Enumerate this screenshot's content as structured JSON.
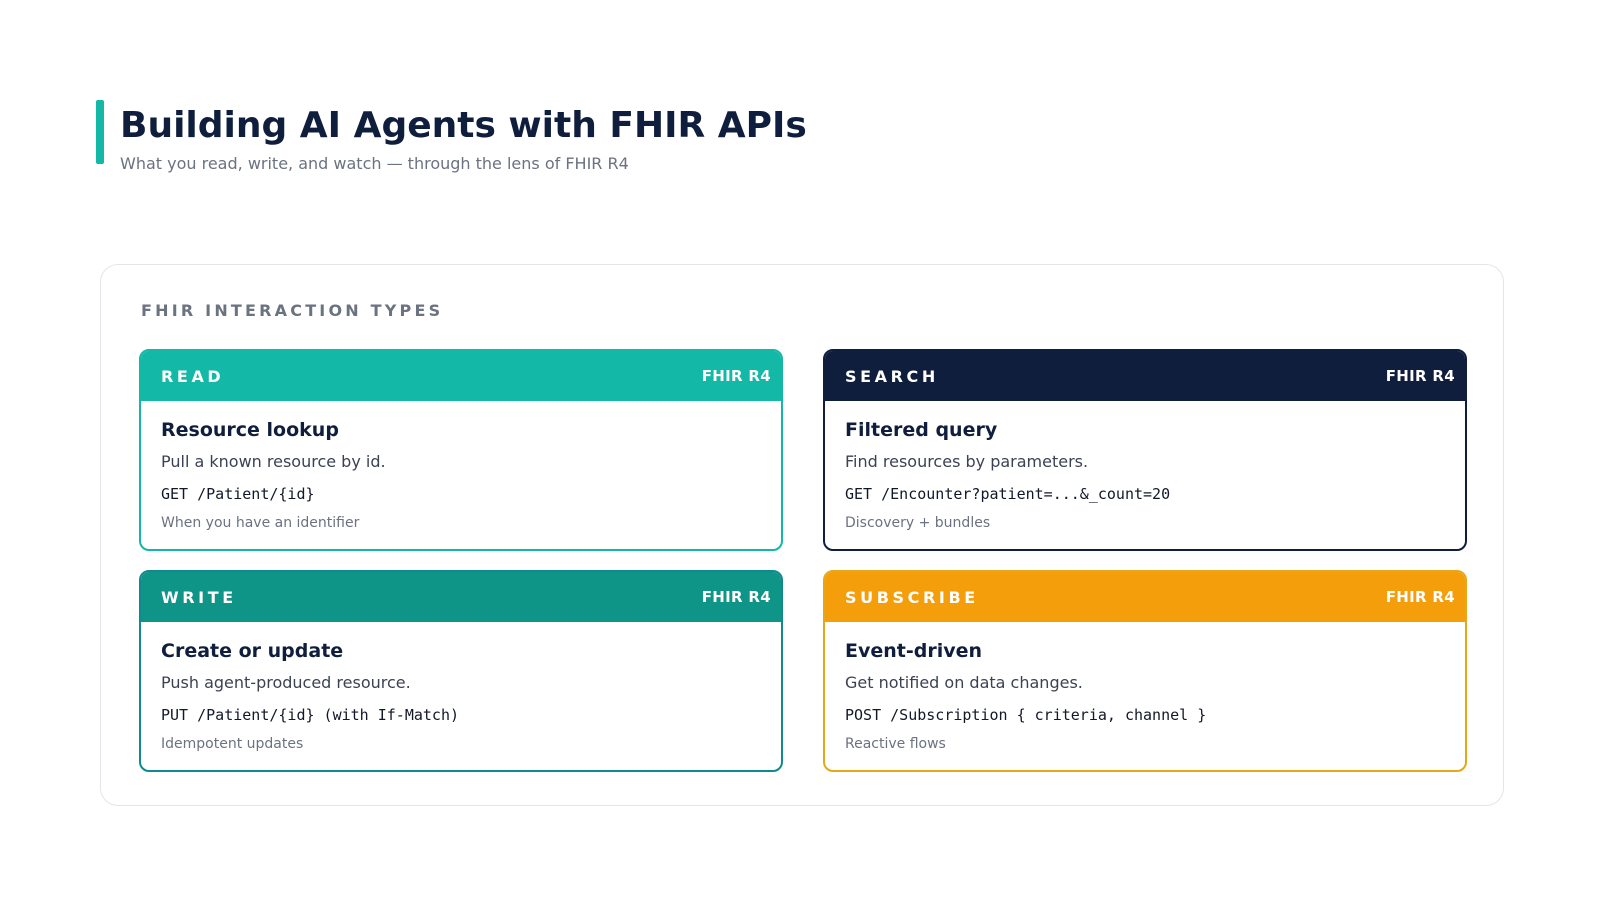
{
  "header": {
    "title": "Building AI Agents with FHIR APIs",
    "subtitle": "What you read, write, and watch — through the lens of FHIR R4"
  },
  "panel": {
    "title": "FHIR INTERACTION TYPES"
  },
  "colors": {
    "teal": "#14b8a6",
    "navy": "#0f1e3d",
    "dark_teal": "#0f9488",
    "amber": "#f59e0b"
  },
  "cards": [
    {
      "type": "READ",
      "tag": "FHIR R4",
      "heading": "Resource lookup",
      "description": "Pull a known resource by id.",
      "code": "GET /Patient/{id}",
      "note": "When you have an identifier"
    },
    {
      "type": "SEARCH",
      "tag": "FHIR R4",
      "heading": "Filtered query",
      "description": "Find resources by parameters.",
      "code": "GET /Encounter?patient=...&_count=20",
      "note": "Discovery + bundles"
    },
    {
      "type": "WRITE",
      "tag": "FHIR R4",
      "heading": "Create or update",
      "description": "Push agent-produced resource.",
      "code": "PUT /Patient/{id} (with If-Match)",
      "note": "Idempotent updates"
    },
    {
      "type": "SUBSCRIBE",
      "tag": "FHIR R4",
      "heading": "Event-driven",
      "description": "Get notified on data changes.",
      "code": "POST /Subscription { criteria, channel }",
      "note": "Reactive flows"
    }
  ]
}
